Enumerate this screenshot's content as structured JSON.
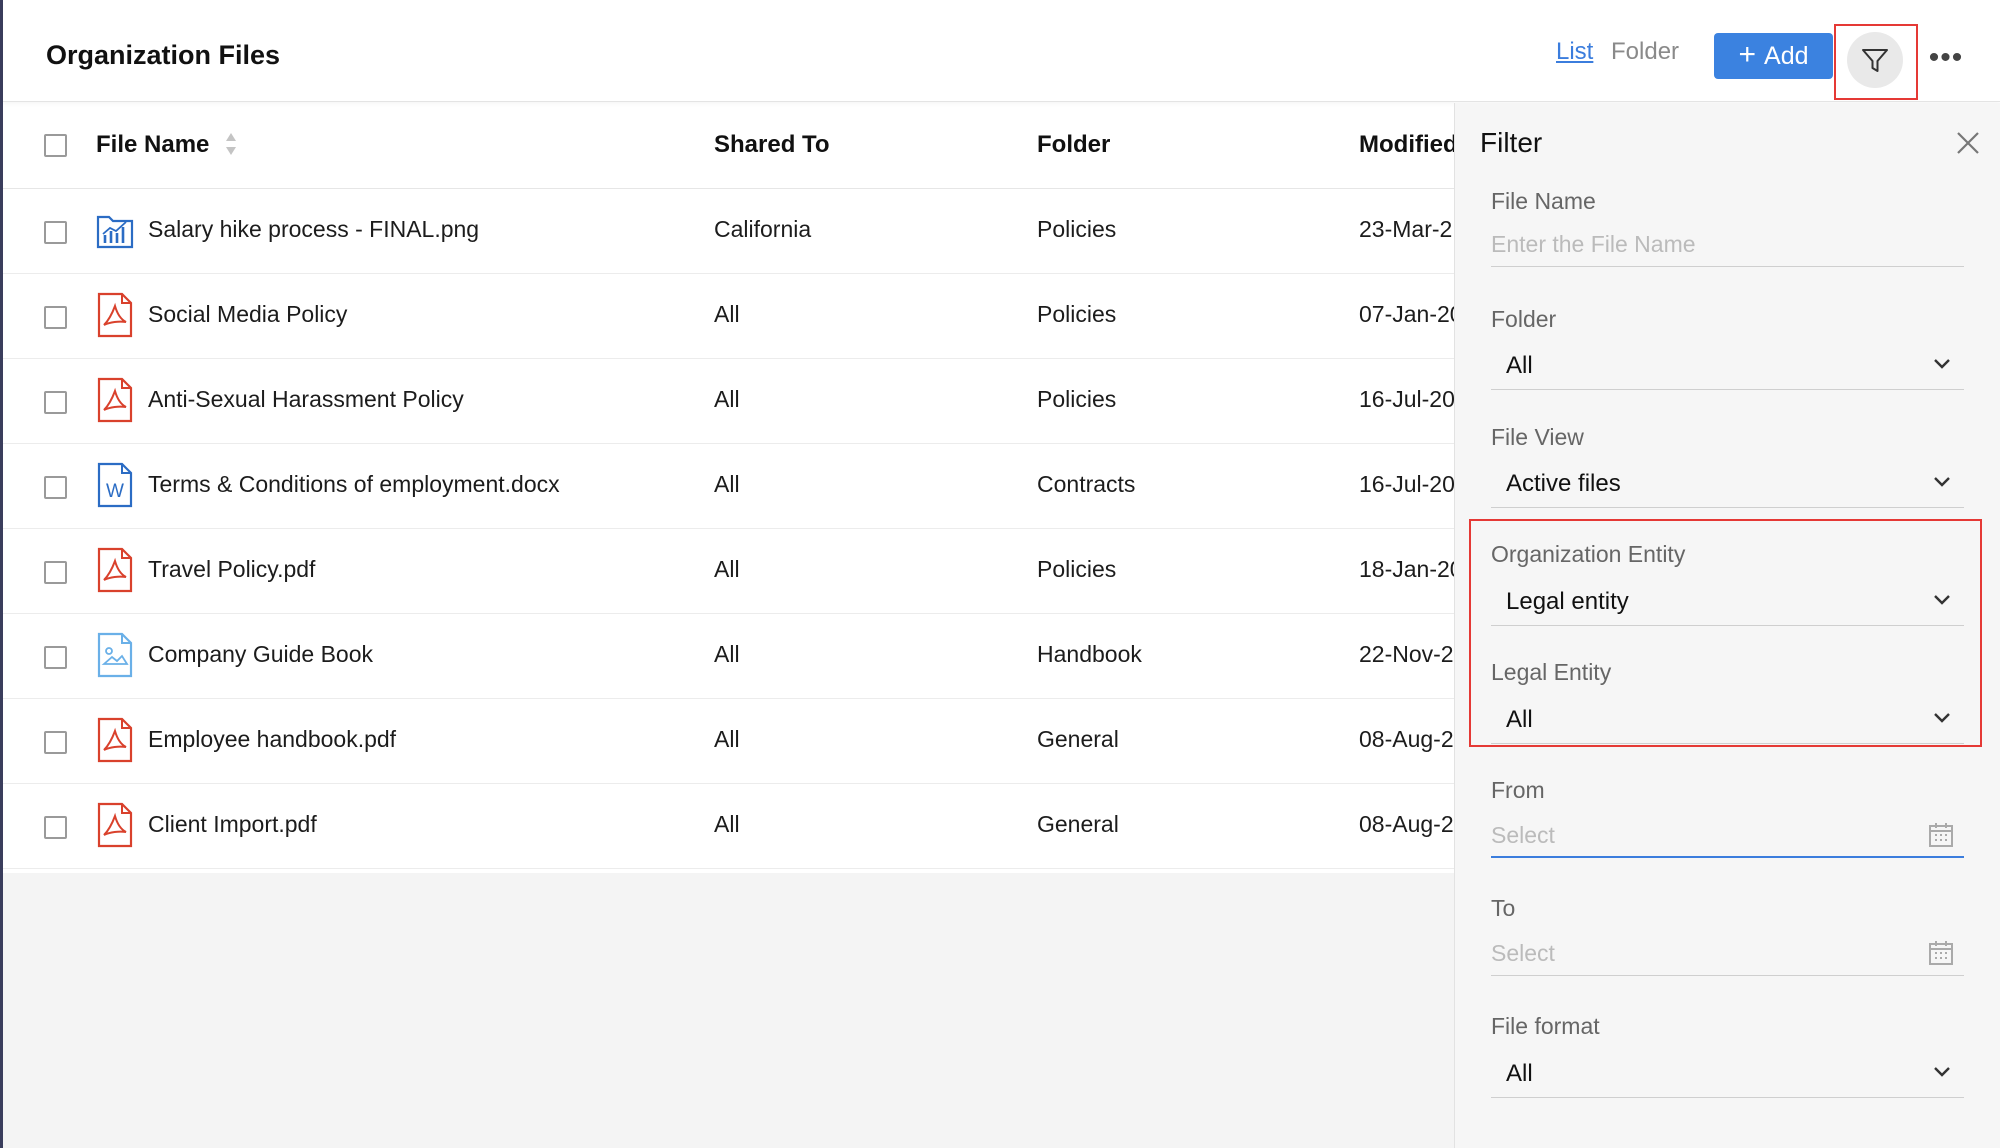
{
  "header": {
    "title": "Organization Files",
    "view_list": "List",
    "view_folder": "Folder",
    "add_label": "Add",
    "more_label": "•••"
  },
  "table": {
    "columns": [
      "File Name",
      "Shared To",
      "Folder",
      "Modified"
    ],
    "rows": [
      {
        "name": "Salary hike process - FINAL.png",
        "shared": "California",
        "folder": "Policies",
        "modified": "23-Mar-2",
        "icon": "image-chart-icon"
      },
      {
        "name": "Social Media Policy",
        "shared": "All",
        "folder": "Policies",
        "modified": "07-Jan-20",
        "icon": "pdf-icon"
      },
      {
        "name": "Anti-Sexual Harassment Policy",
        "shared": "All",
        "folder": "Policies",
        "modified": "16-Jul-20",
        "icon": "pdf-icon"
      },
      {
        "name": "Terms & Conditions of employment.docx",
        "shared": "All",
        "folder": "Contracts",
        "modified": "16-Jul-20",
        "icon": "word-doc-icon"
      },
      {
        "name": "Travel Policy.pdf",
        "shared": "All",
        "folder": "Policies",
        "modified": "18-Jan-20",
        "icon": "pdf-icon"
      },
      {
        "name": "Company Guide Book",
        "shared": "All",
        "folder": "Handbook",
        "modified": "22-Nov-2",
        "icon": "image-icon"
      },
      {
        "name": "Employee handbook.pdf",
        "shared": "All",
        "folder": "General",
        "modified": "08-Aug-2",
        "icon": "pdf-icon"
      },
      {
        "name": "Client Import.pdf",
        "shared": "All",
        "folder": "General",
        "modified": "08-Aug-2",
        "icon": "pdf-icon"
      }
    ]
  },
  "filter": {
    "title": "Filter",
    "file_name_label": "File Name",
    "file_name_placeholder": "Enter the File Name",
    "folder_label": "Folder",
    "folder_value": "All",
    "file_view_label": "File View",
    "file_view_value": "Active files",
    "org_entity_label": "Organization Entity",
    "org_entity_value": "Legal entity",
    "legal_entity_label": "Legal Entity",
    "legal_entity_value": "All",
    "from_label": "From",
    "from_placeholder": "Select",
    "to_label": "To",
    "to_placeholder": "Select",
    "file_format_label": "File format",
    "file_format_value": "All"
  },
  "colors": {
    "accent": "#3b82e0",
    "highlight": "#e53935",
    "pdf": "#d9412c",
    "word": "#2b6cc4"
  }
}
